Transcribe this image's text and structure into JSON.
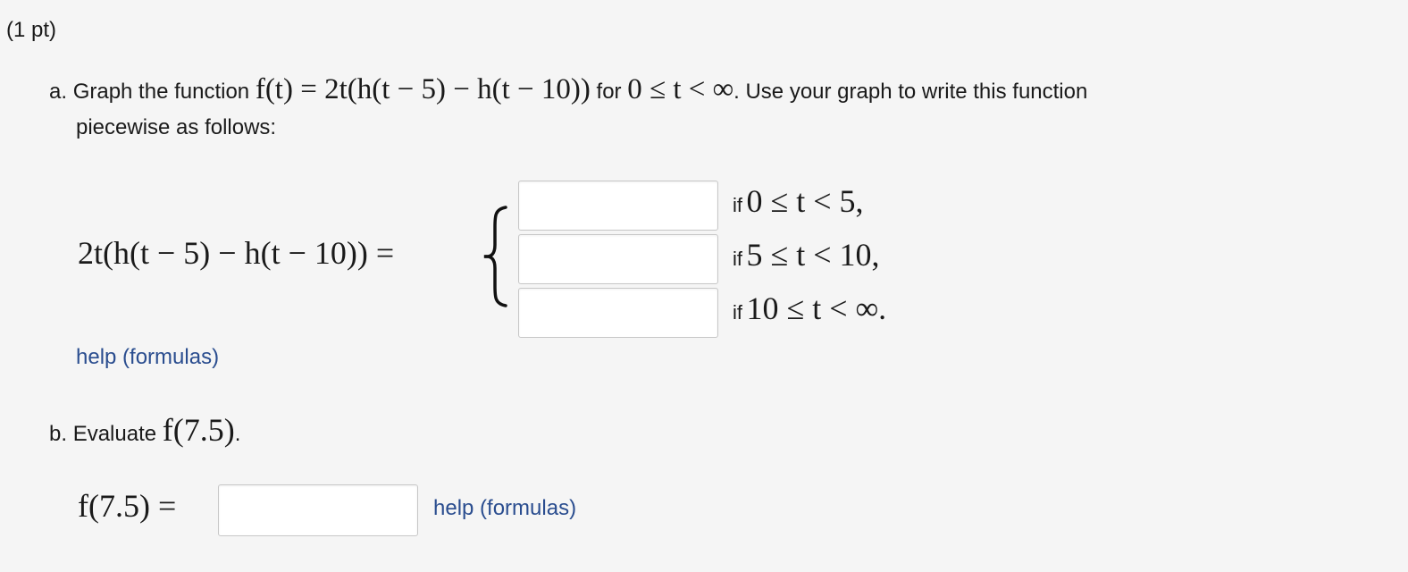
{
  "problem": {
    "points": "(1 pt)"
  },
  "part_a": {
    "label": "a.",
    "text_before": "Graph the function",
    "function_def": "f(t) = 2t(h(t − 5) − h(t − 10))",
    "text_for": "for",
    "domain": "0 ≤ t < ∞",
    "text_after": ". Use your graph to write this function",
    "text_line2": "piecewise as follows:",
    "lhs": "2t(h(t − 5) − h(t − 10)) =",
    "pieces": [
      {
        "if_label": "if",
        "condition": "0 ≤ t < 5,",
        "value": ""
      },
      {
        "if_label": "if",
        "condition": "5 ≤ t < 10,",
        "value": ""
      },
      {
        "if_label": "if",
        "condition": "10 ≤ t < ∞.",
        "value": ""
      }
    ],
    "help_link": "help (formulas)"
  },
  "part_b": {
    "label": "b.",
    "text": "Evaluate",
    "expr": "f(7.5)",
    "period": ".",
    "answer_label": "f(7.5) =",
    "answer_value": "",
    "help_link": "help (formulas)"
  }
}
